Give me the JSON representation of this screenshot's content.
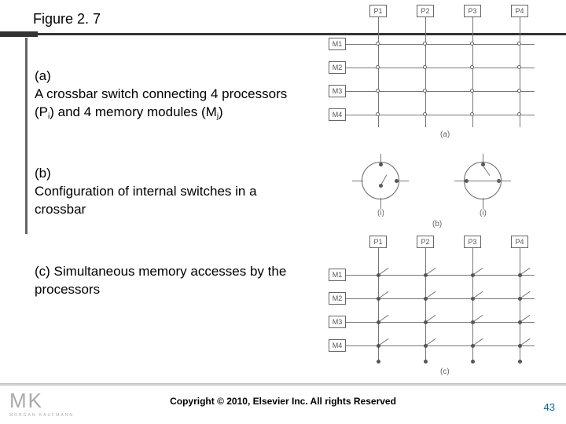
{
  "title": "Figure 2. 7",
  "sections": {
    "a": {
      "label": "(a)",
      "text": "A crossbar switch connecting 4 processors (P",
      "sub": "i",
      "text2": ") and 4 memory modules (M",
      "sub2": "j",
      "text3": ")"
    },
    "b": {
      "label": "(b)",
      "text": "Configuration of internal switches in a crossbar"
    },
    "c": {
      "label": "(c) Simultaneous memory accesses by the processors"
    }
  },
  "diagrams": {
    "a": {
      "processors": [
        "P1",
        "P2",
        "P3",
        "P4"
      ],
      "memories": [
        "M1",
        "M2",
        "M3",
        "M4"
      ],
      "caption": "(a)"
    },
    "b": {
      "left_label": "(i)",
      "right_label": "(i)",
      "caption": "(b)"
    },
    "c": {
      "processors": [
        "P1",
        "P2",
        "P3",
        "P4"
      ],
      "memories": [
        "M1",
        "M2",
        "M3",
        "M4"
      ],
      "caption": "(c)"
    }
  },
  "footer": {
    "copyright": "Copyright © 2010, Elsevier Inc. All rights Reserved",
    "page": "43",
    "logo": "MK",
    "logo_sub": "MORGAN KAUFMANN"
  }
}
